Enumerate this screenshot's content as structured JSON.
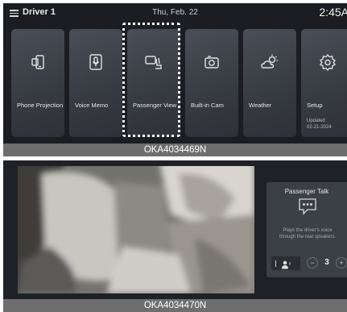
{
  "screen1": {
    "driver_label": "Driver 1",
    "date": "Thu, Feb. 22",
    "time": "2:45",
    "time_suffix": "A",
    "tiles": [
      {
        "label": "Phone Projection",
        "icon": "phone-projection-icon"
      },
      {
        "label": "Voice Memo",
        "icon": "voice-memo-icon"
      },
      {
        "label": "Passenger View",
        "icon": "passenger-view-icon",
        "highlighted": true
      },
      {
        "label": "Built-in Cam",
        "icon": "camera-icon"
      },
      {
        "label": "Weather",
        "icon": "weather-icon"
      },
      {
        "label": "Setup",
        "icon": "gear-icon",
        "sub": "Updated",
        "sub2": "02-21-2024"
      }
    ]
  },
  "caption1": "OKA4034469N",
  "screen2": {
    "panel_title": "Passenger Talk",
    "panel_desc_line1": "Plays the driver's voice",
    "panel_desc_line2": "through the rear speakers.",
    "volume": "3",
    "minus": "−",
    "plus": "+"
  },
  "caption2": "OKA4034470N",
  "colors": {
    "screen_bg": "#1b1d22",
    "tile_bg": "#3e4249",
    "caption_bg": "#6e6e6e",
    "panel_bg": "#3b3f46"
  }
}
